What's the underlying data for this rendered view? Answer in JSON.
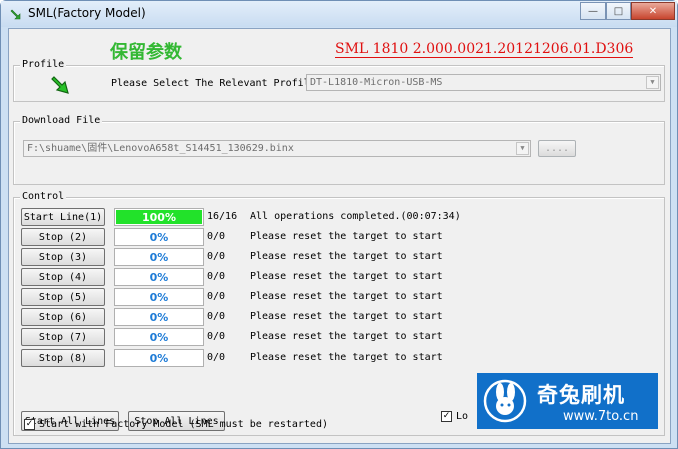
{
  "window": {
    "title": "SML(Factory Model)"
  },
  "header": {
    "cn_title": "保留参数",
    "version": "SML 1810 2.000.0021.20121206.01.D306"
  },
  "profile": {
    "group_label": "Profile",
    "prompt": "Please Select The Relevant Profile",
    "selected": "DT-L1810-Micron-USB-MS"
  },
  "download": {
    "group_label": "Download File",
    "path": "F:\\shuame\\固件\\LenovoA658t_S14451_130629.binx",
    "browse_label": "...."
  },
  "control": {
    "group_label": "Control",
    "lines": [
      {
        "button": "Start Line(1)",
        "percent": "100%",
        "progress": 1.0,
        "count": "16/16",
        "status": "All operations completed.(00:07:34)"
      },
      {
        "button": "Stop (2)",
        "percent": "0%",
        "progress": 0,
        "count": "0/0",
        "status": "Please reset the target to start"
      },
      {
        "button": "Stop (3)",
        "percent": "0%",
        "progress": 0,
        "count": "0/0",
        "status": "Please reset the target to start"
      },
      {
        "button": "Stop (4)",
        "percent": "0%",
        "progress": 0,
        "count": "0/0",
        "status": "Please reset the target to start"
      },
      {
        "button": "Stop (5)",
        "percent": "0%",
        "progress": 0,
        "count": "0/0",
        "status": "Please reset the target to start"
      },
      {
        "button": "Stop (6)",
        "percent": "0%",
        "progress": 0,
        "count": "0/0",
        "status": "Please reset the target to start"
      },
      {
        "button": "Stop (7)",
        "percent": "0%",
        "progress": 0,
        "count": "0/0",
        "status": "Please reset the target to start"
      },
      {
        "button": "Stop (8)",
        "percent": "0%",
        "progress": 0,
        "count": "0/0",
        "status": "Please reset the target to start"
      }
    ],
    "start_all": "Start All Lines",
    "stop_all": "Stop All Lines",
    "lock_label": "Lo"
  },
  "factory": {
    "label": "Start with Factory Model (SML must be restarted)"
  },
  "watermark": {
    "cn": "奇兔刷机",
    "url": "www.7to.cn"
  }
}
